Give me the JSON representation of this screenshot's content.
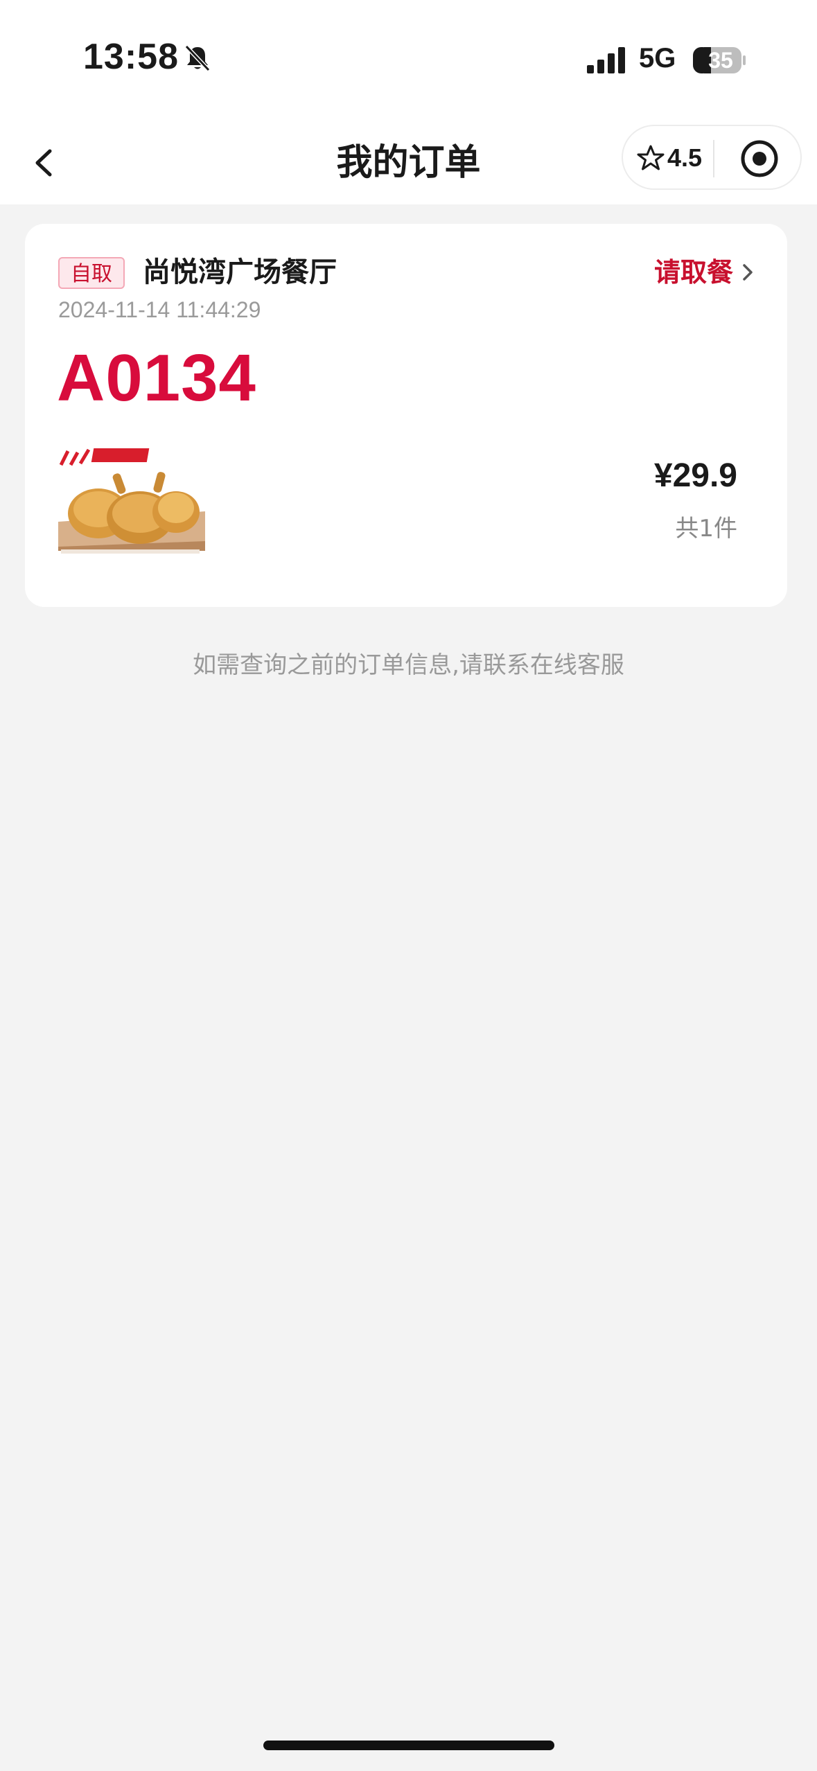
{
  "status_bar": {
    "time": "13:58",
    "network": "5G",
    "battery_level": "35",
    "icons": [
      "bell-off-icon",
      "signal-icon",
      "battery-icon"
    ]
  },
  "nav": {
    "back_icon": "chevron-left-icon",
    "title": "我的订单",
    "rating": "4.5",
    "rating_icon": "star-outline-icon",
    "capsule_icon": "target-circle-icon"
  },
  "order": {
    "tag": "自取",
    "store_name": "尚悦湾广场餐厅",
    "action_label": "请取餐",
    "action_icon": "chevron-right-icon",
    "time": "2024-11-14 11:44:29",
    "pickup_code": "A0134",
    "product_image_desc": "fried-chicken-drumsticks",
    "price": "¥29.9",
    "item_count": "共1件"
  },
  "footer": {
    "note": "如需查询之前的订单信息,请联系在线客服"
  },
  "colors": {
    "accent": "#c8102e",
    "code_red": "#d80c3c",
    "background": "#f3f3f3",
    "card": "#ffffff"
  }
}
